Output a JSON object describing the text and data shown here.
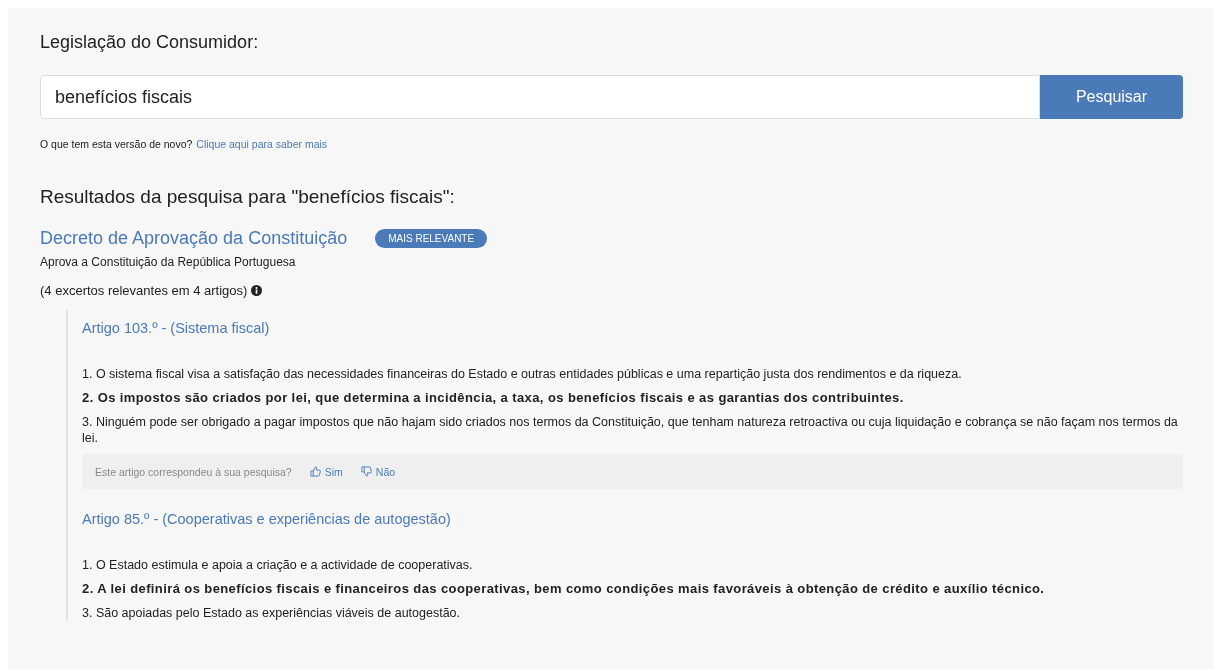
{
  "heading": "Legislação do Consumidor:",
  "search": {
    "value": "benefícios fiscais",
    "button": "Pesquisar"
  },
  "news": {
    "text": "O que tem esta versão de novo?",
    "link": "Clique aqui para saber mais"
  },
  "results_title": "Resultados da pesquisa para \"benefícios fiscais\":",
  "results": [
    {
      "title": "Decreto de Aprovação da Constituição",
      "badge": "MAIS RELEVANTE",
      "subtitle": "Aprova a Constituição da República Portuguesa",
      "excerpts": "(4 excertos relevantes em 4 artigos)",
      "articles": [
        {
          "title": "Artigo 103.º - (Sistema fiscal)",
          "paragraphs": [
            {
              "text": "1. O sistema fiscal visa a satisfação das necessidades financeiras do Estado e outras entidades públicas e uma repartição justa dos rendimentos e da riqueza.",
              "highlighted": false
            },
            {
              "text": "2. Os impostos são criados por lei, que determina a incidência, a taxa, os benefícios fiscais e as garantias dos contribuintes.",
              "highlighted": true
            },
            {
              "text": "3. Ninguém pode ser obrigado a pagar impostos que não hajam sido criados nos termos da Constituição, que tenham natureza retroactiva ou cuja liquidação e cobrança se não façam nos termos da lei.",
              "highlighted": false
            }
          ],
          "feedback": {
            "question": "Este artigo correspondeu à sua pesquisa?",
            "yes": "Sim",
            "no": "Não"
          }
        },
        {
          "title": "Artigo 85.º - (Cooperativas e experiências de autogestão)",
          "paragraphs": [
            {
              "text": "1. O Estado estimula e apoia a criação e a actividade de cooperativas.",
              "highlighted": false
            },
            {
              "text": "2. A lei definirá os benefícios fiscais e financeiros das cooperativas, bem como condições mais favoráveis à obtenção de crédito e auxílio técnico.",
              "highlighted": true
            },
            {
              "text": "3. São apoiadas pelo Estado as experiências viáveis de autogestão.",
              "highlighted": false
            }
          ]
        }
      ]
    }
  ]
}
